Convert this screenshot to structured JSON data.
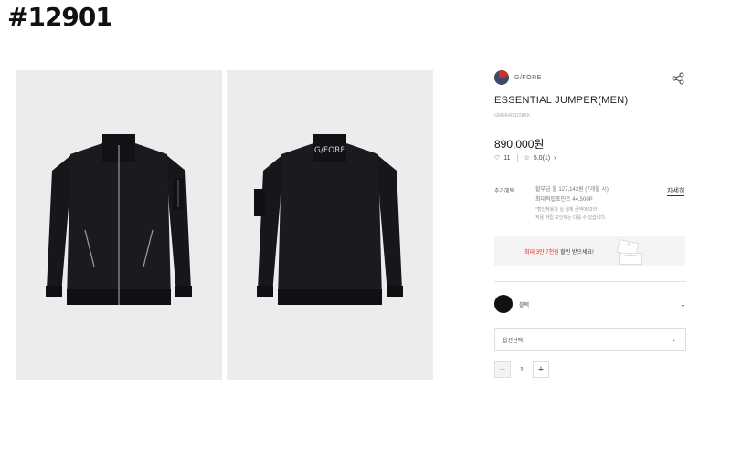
{
  "header": {
    "id_label": "#12901"
  },
  "product": {
    "brand": "G/FORE",
    "title": "ESSENTIAL JUMPER(MEN)",
    "code": "GMUA4D3158KK",
    "price": "890,000원",
    "likes": "11",
    "rating": "5.0(1)",
    "back_collar_text": "G/FORE"
  },
  "points": {
    "label": "추가혜택",
    "line1": "할부금 월 127,143원 (7개월 시)",
    "line2": "최대적립포인트 44,500P",
    "note1": "*할인적용과 실 결제 금액에 따라",
    "note2": "적용 적립 포인트는 다를 수 있습니다.",
    "detail_link": "자세히"
  },
  "promo": {
    "red_text": "최대 3만 7천원",
    "text": " 할인 받으세요!",
    "card_top": "G",
    "card_bottom": "COUPON"
  },
  "options": {
    "color_name": "블랙",
    "select_placeholder": "옵션선택",
    "quantity": "1"
  },
  "icons": {
    "share": "share-icon",
    "heart": "heart-icon",
    "star": "star-icon",
    "chevron": "chevron-down-icon",
    "minus": "minus-icon",
    "plus": "plus-icon"
  },
  "colors": {
    "accent_red": "#d3312c",
    "jacket": "#15161a",
    "panel_bg": "#ececec"
  }
}
